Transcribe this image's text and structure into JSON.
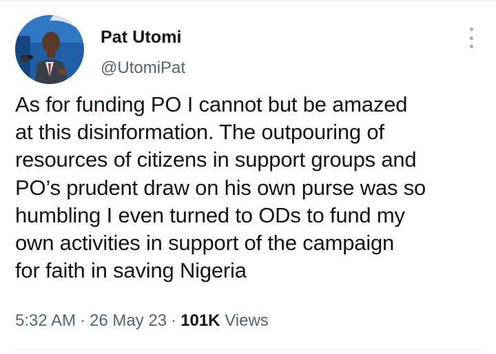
{
  "author": {
    "display_name": "Pat Utomi",
    "handle": "@UtomiPat",
    "avatar_icon": "profile-photo"
  },
  "more_icon": "more-options-vertical-icon",
  "tweet": {
    "lines": [
      "As for funding PO I cannot but be amazed",
      "at this disinformation. The outpouring of",
      "resources of citizens in support groups and",
      "PO’s prudent draw on his own purse was so",
      "humbling I even turned to ODs to fund my",
      "own activities in support of the campaign",
      "for faith in saving Nigeria"
    ]
  },
  "meta": {
    "time": "5:32 AM",
    "separator": "·",
    "date": "26 May 23",
    "views_count": "101K",
    "views_label": "Views"
  },
  "colors": {
    "text": "#0f1419",
    "secondary": "#536471",
    "divider": "#e6ecf0"
  }
}
